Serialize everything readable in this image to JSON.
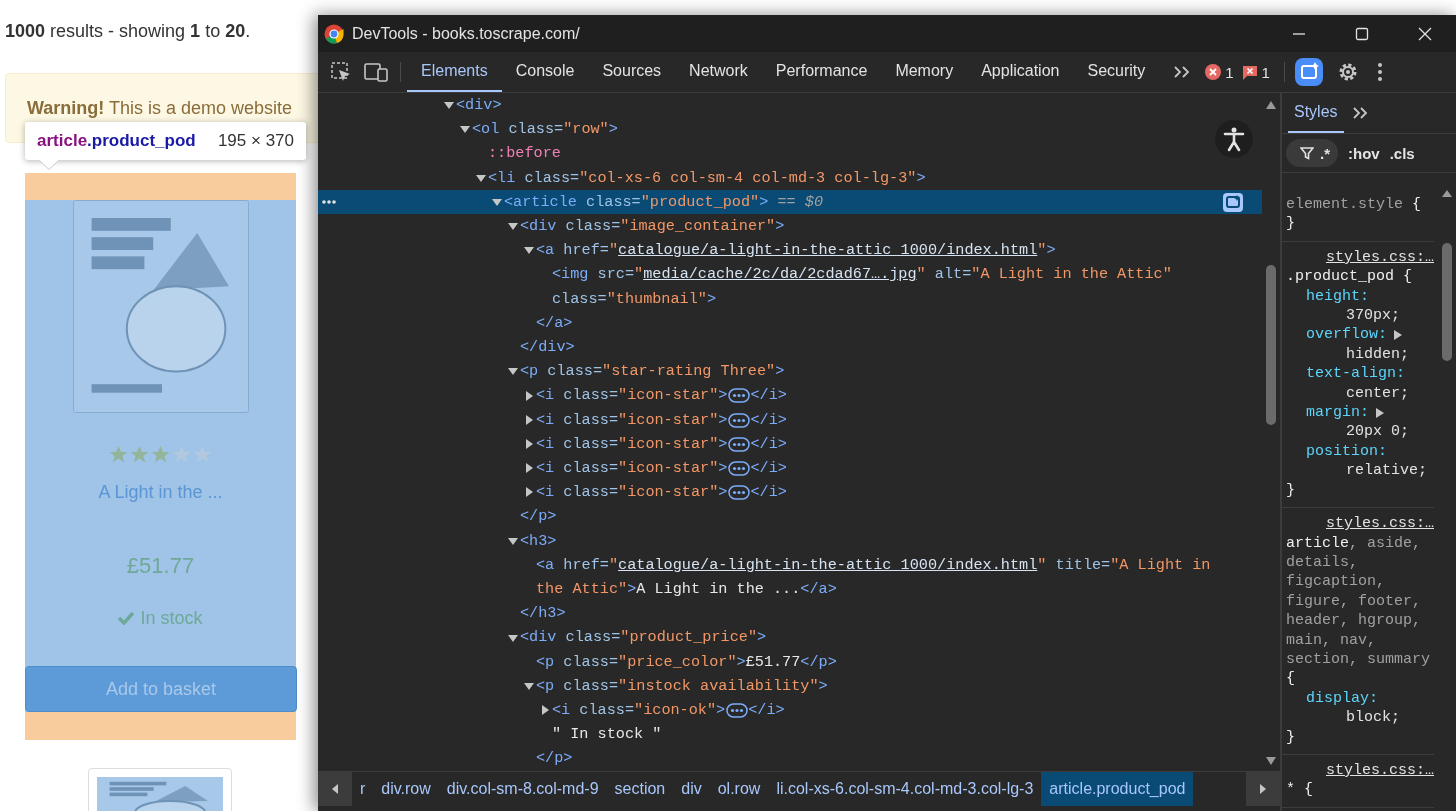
{
  "page": {
    "summary": "**1000** results - showing **1** to **20**.",
    "warning": "**Warning!** This is a demo website",
    "tooltip": {
      "tag": "article",
      "class": ".product_pod",
      "size": "195 × 370"
    },
    "product": {
      "stars": 3,
      "title": "A Light in the ...",
      "price": "£51.77",
      "availability": "In stock",
      "button": "Add to basket"
    }
  },
  "devtools": {
    "title": "DevTools - books.toscrape.com/",
    "tabs": [
      {
        "label": "Elements",
        "selected": true
      },
      {
        "label": "Console",
        "selected": false
      },
      {
        "label": "Sources",
        "selected": false
      },
      {
        "label": "Network",
        "selected": false
      },
      {
        "label": "Performance",
        "selected": false
      },
      {
        "label": "Memory",
        "selected": false
      },
      {
        "label": "Application",
        "selected": false
      },
      {
        "label": "Security",
        "selected": false
      }
    ],
    "error_count": "1",
    "issue_count": "1",
    "tree": [
      {
        "selected": false,
        "expanded": true,
        "tokens": [
          {
            "kind": "tag",
            "text": "<div>"
          }
        ],
        "children": [
          {
            "selected": false,
            "expanded": true,
            "tokens": [
              {
                "kind": "tag",
                "text": "<ol"
              },
              {
                "kind": "attr",
                "text": " class="
              },
              {
                "kind": "value",
                "text": "\"row\""
              },
              {
                "kind": "tag",
                "text": ">"
              }
            ],
            "children": [
              {
                "selected": false,
                "tokens": [
                  {
                    "kind": "pseudo",
                    "text": "::before"
                  }
                ]
              },
              {
                "selected": false,
                "expanded": true,
                "tokens": [
                  {
                    "kind": "tag",
                    "text": "<li"
                  },
                  {
                    "kind": "attr",
                    "text": " class="
                  },
                  {
                    "kind": "value",
                    "text": "\"col-xs-6 col-sm-4 col-md-3 col-lg-3\""
                  },
                  {
                    "kind": "tag",
                    "text": ">"
                  }
                ],
                "children": [
                  {
                    "selected": true,
                    "expanded": true,
                    "tokens": [
                      {
                        "kind": "tag",
                        "text": "<article"
                      },
                      {
                        "kind": "attr",
                        "text": " class="
                      },
                      {
                        "kind": "value",
                        "text": "\"product_pod\""
                      },
                      {
                        "kind": "tag",
                        "text": ">"
                      },
                      {
                        "kind": "note",
                        "text": " == $0"
                      }
                    ],
                    "children": [
                      {
                        "selected": false,
                        "expanded": true,
                        "tokens": [
                          {
                            "kind": "tag",
                            "text": "<div"
                          },
                          {
                            "kind": "attr",
                            "text": " class="
                          },
                          {
                            "kind": "value",
                            "text": "\"image_container\""
                          },
                          {
                            "kind": "tag",
                            "text": ">"
                          }
                        ],
                        "closing": [
                          {
                            "kind": "tag",
                            "text": "</div>"
                          }
                        ],
                        "children": [
                          {
                            "selected": false,
                            "expanded": true,
                            "tokens": [
                              {
                                "kind": "tag",
                                "text": "<a"
                              },
                              {
                                "kind": "attr",
                                "text": " href="
                              },
                              {
                                "kind": "value",
                                "text": "\""
                              },
                              {
                                "kind": "link",
                                "text": "catalogue/a-light-in-the-attic_1000/index.html"
                              },
                              {
                                "kind": "value",
                                "text": "\""
                              },
                              {
                                "kind": "tag",
                                "text": ">"
                              }
                            ],
                            "closing": [
                              {
                                "kind": "tag",
                                "text": "</a>"
                              }
                            ],
                            "children": [
                              {
                                "selected": false,
                                "tokens": [
                                  {
                                    "kind": "tag",
                                    "text": "<img"
                                  },
                                  {
                                    "kind": "attr",
                                    "text": " src="
                                  },
                                  {
                                    "kind": "value",
                                    "text": "\""
                                  },
                                  {
                                    "kind": "link",
                                    "text": "media/cache/2c/da/2cdad67….jpg"
                                  },
                                  {
                                    "kind": "value",
                                    "text": "\""
                                  },
                                  {
                                    "kind": "attr",
                                    "text": " alt="
                                  },
                                  {
                                    "kind": "value",
                                    "text": "\"A Light in the Attic\""
                                  },
                                  {
                                    "kind": "attr",
                                    "text": " class="
                                  },
                                  {
                                    "kind": "value",
                                    "text": "\"thumbnail\""
                                  },
                                  {
                                    "kind": "tag",
                                    "text": ">"
                                  }
                                ]
                              }
                            ]
                          }
                        ]
                      },
                      {
                        "selected": false,
                        "expanded": true,
                        "tokens": [
                          {
                            "kind": "tag",
                            "text": "<p"
                          },
                          {
                            "kind": "attr",
                            "text": " class="
                          },
                          {
                            "kind": "value",
                            "text": "\"star-rating Three\""
                          },
                          {
                            "kind": "tag",
                            "text": ">"
                          }
                        ],
                        "closing": [
                          {
                            "kind": "tag",
                            "text": "</p>"
                          }
                        ],
                        "children": [
                          {
                            "selected": false,
                            "expanded": false,
                            "tokens": [
                              {
                                "kind": "tag",
                                "text": "<i"
                              },
                              {
                                "kind": "attr",
                                "text": " class="
                              },
                              {
                                "kind": "value",
                                "text": "\"icon-star\""
                              },
                              {
                                "kind": "tag",
                                "text": ">"
                              }
                            ],
                            "tail": [
                              {
                                "kind": "tag",
                                "text": "</i>"
                              }
                            ]
                          },
                          {
                            "selected": false,
                            "expanded": false,
                            "tokens": [
                              {
                                "kind": "tag",
                                "text": "<i"
                              },
                              {
                                "kind": "attr",
                                "text": " class="
                              },
                              {
                                "kind": "value",
                                "text": "\"icon-star\""
                              },
                              {
                                "kind": "tag",
                                "text": ">"
                              }
                            ],
                            "tail": [
                              {
                                "kind": "tag",
                                "text": "</i>"
                              }
                            ]
                          },
                          {
                            "selected": false,
                            "expanded": false,
                            "tokens": [
                              {
                                "kind": "tag",
                                "text": "<i"
                              },
                              {
                                "kind": "attr",
                                "text": " class="
                              },
                              {
                                "kind": "value",
                                "text": "\"icon-star\""
                              },
                              {
                                "kind": "tag",
                                "text": ">"
                              }
                            ],
                            "tail": [
                              {
                                "kind": "tag",
                                "text": "</i>"
                              }
                            ]
                          },
                          {
                            "selected": false,
                            "expanded": false,
                            "tokens": [
                              {
                                "kind": "tag",
                                "text": "<i"
                              },
                              {
                                "kind": "attr",
                                "text": " class="
                              },
                              {
                                "kind": "value",
                                "text": "\"icon-star\""
                              },
                              {
                                "kind": "tag",
                                "text": ">"
                              }
                            ],
                            "tail": [
                              {
                                "kind": "tag",
                                "text": "</i>"
                              }
                            ]
                          },
                          {
                            "selected": false,
                            "expanded": false,
                            "tokens": [
                              {
                                "kind": "tag",
                                "text": "<i"
                              },
                              {
                                "kind": "attr",
                                "text": " class="
                              },
                              {
                                "kind": "value",
                                "text": "\"icon-star\""
                              },
                              {
                                "kind": "tag",
                                "text": ">"
                              }
                            ],
                            "tail": [
                              {
                                "kind": "tag",
                                "text": "</i>"
                              }
                            ]
                          }
                        ]
                      },
                      {
                        "selected": false,
                        "expanded": true,
                        "tokens": [
                          {
                            "kind": "tag",
                            "text": "<h3>"
                          }
                        ],
                        "closing": [
                          {
                            "kind": "tag",
                            "text": "</h3>"
                          }
                        ],
                        "children": [
                          {
                            "selected": false,
                            "tokens": [
                              {
                                "kind": "tag",
                                "text": "<a"
                              },
                              {
                                "kind": "attr",
                                "text": " href="
                              },
                              {
                                "kind": "value",
                                "text": "\""
                              },
                              {
                                "kind": "link",
                                "text": "catalogue/a-light-in-the-attic_1000/index.html"
                              },
                              {
                                "kind": "value",
                                "text": "\""
                              },
                              {
                                "kind": "attr",
                                "text": " title="
                              },
                              {
                                "kind": "value",
                                "text": "\"A Light in the Attic\""
                              },
                              {
                                "kind": "tag",
                                "text": ">"
                              },
                              {
                                "kind": "text",
                                "text": "A Light in the ..."
                              },
                              {
                                "kind": "tag",
                                "text": "</a>"
                              }
                            ]
                          }
                        ]
                      },
                      {
                        "selected": false,
                        "expanded": true,
                        "tokens": [
                          {
                            "kind": "tag",
                            "text": "<div"
                          },
                          {
                            "kind": "attr",
                            "text": " class="
                          },
                          {
                            "kind": "value",
                            "text": "\"product_price\""
                          },
                          {
                            "kind": "tag",
                            "text": ">"
                          }
                        ],
                        "children": [
                          {
                            "selected": false,
                            "tokens": [
                              {
                                "kind": "tag",
                                "text": "<p"
                              },
                              {
                                "kind": "attr",
                                "text": " class="
                              },
                              {
                                "kind": "value",
                                "text": "\"price_color\""
                              },
                              {
                                "kind": "tag",
                                "text": ">"
                              },
                              {
                                "kind": "text",
                                "text": "£51.77"
                              },
                              {
                                "kind": "tag",
                                "text": "</p>"
                              }
                            ]
                          },
                          {
                            "selected": false,
                            "expanded": true,
                            "tokens": [
                              {
                                "kind": "tag",
                                "text": "<p"
                              },
                              {
                                "kind": "attr",
                                "text": " class="
                              },
                              {
                                "kind": "value",
                                "text": "\"instock availability\""
                              },
                              {
                                "kind": "tag",
                                "text": ">"
                              }
                            ],
                            "closing": [
                              {
                                "kind": "tag",
                                "text": "</p>"
                              }
                            ],
                            "children": [
                              {
                                "selected": false,
                                "expanded": false,
                                "tokens": [
                                  {
                                    "kind": "tag",
                                    "text": "<i"
                                  },
                                  {
                                    "kind": "attr",
                                    "text": " class="
                                  },
                                  {
                                    "kind": "value",
                                    "text": "\"icon-ok\""
                                  },
                                  {
                                    "kind": "tag",
                                    "text": ">"
                                  }
                                ],
                                "tail": [
                                  {
                                    "kind": "tag",
                                    "text": "</i>"
                                  }
                                ]
                              },
                              {
                                "selected": false,
                                "tokens": [
                                  {
                                    "kind": "text",
                                    "text": "\" In stock \""
                                  }
                                ]
                              }
                            ]
                          }
                        ]
                      }
                    ]
                  }
                ]
              }
            ]
          }
        ]
      }
    ],
    "breadcrumbs": [
      {
        "label": "r",
        "selected": false
      },
      {
        "label": "div.row",
        "selected": false
      },
      {
        "label": "div.col-sm-8.col-md-9",
        "selected": false
      },
      {
        "label": "section",
        "selected": false
      },
      {
        "label": "div",
        "selected": false
      },
      {
        "label": "ol.row",
        "selected": false
      },
      {
        "label": "li.col-xs-6.col-sm-4.col-md-3.col-lg-3",
        "selected": false
      },
      {
        "label": "article.product_pod",
        "selected": true
      }
    ],
    "styles": {
      "tabs": [
        {
          "label": "Styles",
          "selected": true
        }
      ],
      "regex": ".*",
      "hov": ":hov",
      "cls": ".cls",
      "rules": [
        {
          "selector": [
            {
              "text": "element.style",
              "matched": false
            }
          ],
          "brace": "{",
          "close": "}"
        },
        {
          "source": "styles.css:…",
          "selector": [
            {
              "text": ".product_pod",
              "matched": true
            }
          ],
          "brace": "{",
          "declarations": [
            {
              "property": "height:",
              "value": "370px;",
              "expandable": false
            },
            {
              "property": "overflow:",
              "value": "hidden;",
              "expandable": true
            },
            {
              "property": "text-align:",
              "value": "center;",
              "expandable": false
            },
            {
              "property": "margin:",
              "value": "20px 0;",
              "expandable": true
            },
            {
              "property": "position:",
              "value": "relative;",
              "expandable": false
            }
          ],
          "close": "}"
        },
        {
          "source": "styles.css:…",
          "selector": [
            {
              "text": "article",
              "matched": true
            },
            {
              "text": ", aside, details, figcaption, figure, footer, header, hgroup, main, nav, section, summary",
              "matched": false
            }
          ],
          "brace": "{",
          "declarations": [
            {
              "property": "display:",
              "value": "block;",
              "expandable": false
            }
          ],
          "close": "}"
        },
        {
          "source": "styles.css:…",
          "selector": [
            {
              "text": "*",
              "matched": true
            }
          ],
          "brace": "{"
        }
      ]
    }
  }
}
